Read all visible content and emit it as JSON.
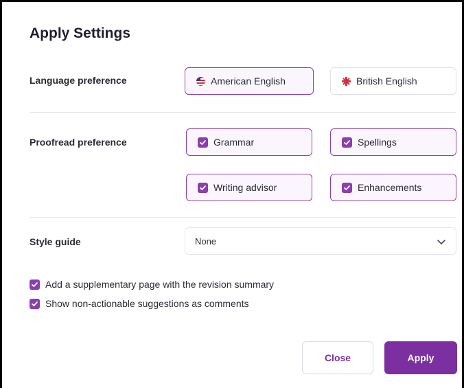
{
  "dialog": {
    "title": "Apply Settings"
  },
  "language": {
    "label": "Language preference",
    "options": [
      {
        "label": "American English",
        "selected": true,
        "flag": "us-flag-icon"
      },
      {
        "label": "British English",
        "selected": false,
        "flag": "uk-flag-icon"
      }
    ]
  },
  "proofread": {
    "label": "Proofread preference",
    "options": [
      {
        "label": "Grammar",
        "checked": true
      },
      {
        "label": "Spellings",
        "checked": true
      },
      {
        "label": "Writing advisor",
        "checked": true
      },
      {
        "label": "Enhancements",
        "checked": true
      }
    ]
  },
  "style_guide": {
    "label": "Style guide",
    "value": "None"
  },
  "extras": [
    {
      "label": "Add a supplementary page with the revision summary",
      "checked": true
    },
    {
      "label": "Show non-actionable suggestions as comments",
      "checked": true
    }
  ],
  "buttons": {
    "close": "Close",
    "apply": "Apply"
  },
  "colors": {
    "accent": "#7b2fa0",
    "selected_bg": "#fbf6fd",
    "border": "#e2dfe6"
  }
}
